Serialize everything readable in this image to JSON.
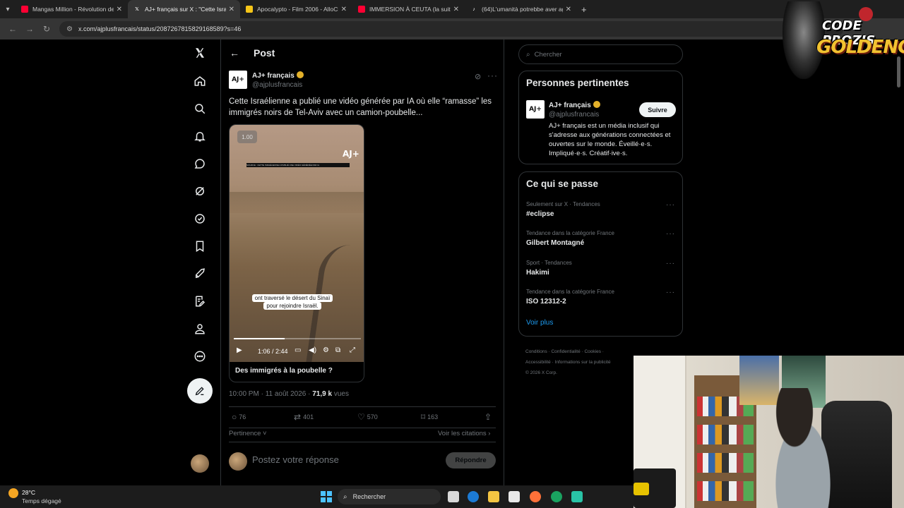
{
  "browser": {
    "tabs": [
      {
        "title": "Mangas Million - Révolution de",
        "favicon_color": "#ff0033",
        "active": false
      },
      {
        "title": "AJ+ français sur X : \"Cette Israé",
        "favicon_color": "#000000",
        "active": true
      },
      {
        "title": "Apocalypto - Film 2006 - AlloCi",
        "favicon_color": "#f5c518",
        "active": false
      },
      {
        "title": "IMMERSION À CEUTA (la suite",
        "favicon_color": "#ff0033",
        "active": false
      },
      {
        "title": "(64)L'umanità potrebbe aver ag",
        "favicon_color": "#111111",
        "active": false
      }
    ],
    "url": "x.com/ajplusfrancais/status/2087267815829168589?s=46"
  },
  "post": {
    "header_title": "Post",
    "author_name": "AJ+ français",
    "author_handle": "@ajplusfrancais",
    "avatar_text": "AJ+",
    "text": "Cette Israélienne a publié une vidéo générée par IA où elle “ramasse” les immigrés noirs de Tel-Aviv avec un camion-poubelle...",
    "video": {
      "speed_badge": "1.00",
      "watermark": "AJ+",
      "headline_strip": "SOURCE : CETTE ISRAÉLIENNE A PUBLIÉ UNE VIDÉO GÉNÉRÉE PAR IA",
      "caption_line1": "ont traversé le désert du Sinaï",
      "caption_line2": "pour rejoindre Israël.",
      "time": "1:06 / 2:44",
      "progress": 0.4
    },
    "card_title": "Des immigrés à la poubelle ?",
    "timestamp": "10:00 PM · 11 août 2026 · ",
    "views_count": "71,9 k",
    "views_label": " vues",
    "stats": {
      "replies": "76",
      "reposts": "401",
      "likes": "570",
      "bookmarks": "163"
    },
    "sort_label": "Pertinence",
    "quotes_label": "Voir les citations",
    "reply_placeholder": "Postez votre réponse",
    "reply_button": "Répondre"
  },
  "sidebar_right": {
    "search_placeholder": "Chercher",
    "relevant_title": "Personnes pertinentes",
    "relevant": {
      "name": "AJ+ français",
      "handle": "@ajplusfrancais",
      "avatar_text": "AJ+",
      "follow_label": "Suivre",
      "bio": "AJ+ français est un média inclusif qui s'adresse aux générations connectées et ouvertes sur le monde. Éveillé·e·s. Impliqué·e·s. Créatif·ive·s."
    },
    "trends_title": "Ce qui se passe",
    "trends": [
      {
        "meta": "Seulement sur X · Tendances",
        "name": "#eclipse"
      },
      {
        "meta": "Tendance dans la catégorie France",
        "name": "Gilbert Montagné"
      },
      {
        "meta": "Sport · Tendances",
        "name": "Hakimi"
      },
      {
        "meta": "Tendance dans la catégorie France",
        "name": "ISO 12312-2"
      }
    ],
    "see_more": "Voir plus",
    "footer": {
      "line1": "Conditions · Confidentialité · Cookies ·",
      "line2": "Accessibilité · Informations sur la publicité",
      "line3": "© 2026 X Corp."
    }
  },
  "overlay": {
    "logo_line1": "CODE PROZIS",
    "logo_line2": "GOLDENG"
  },
  "taskbar": {
    "temperature": "28°C",
    "weather": "Temps dégagé",
    "search_label": "Rechercher"
  },
  "colors": {
    "accent_blue": "#1d9bf0",
    "verified_gold": "#e4b12a",
    "logo_gold": "#f2c230"
  }
}
